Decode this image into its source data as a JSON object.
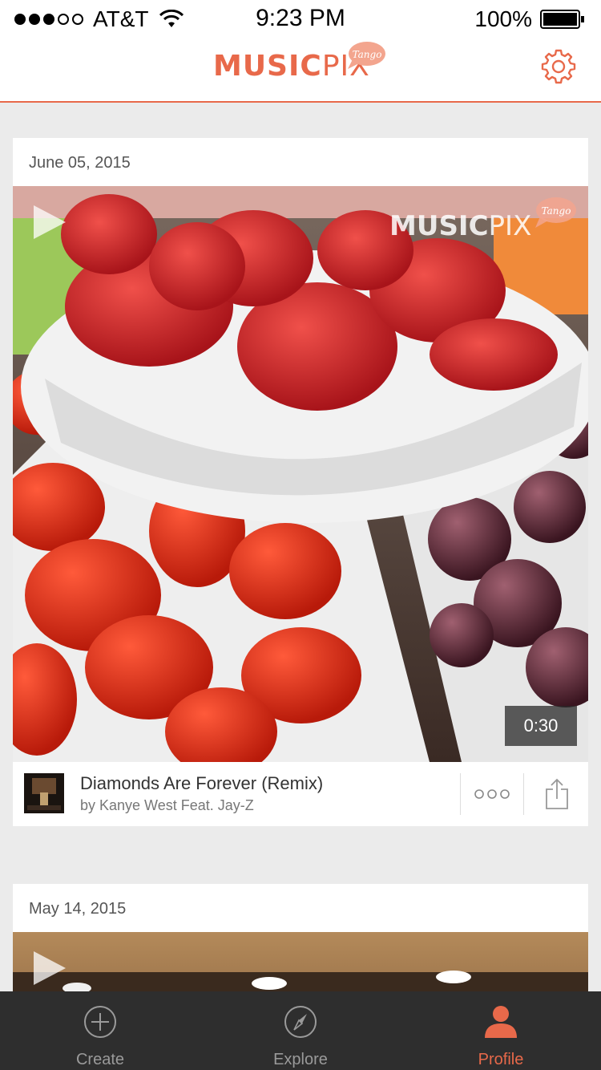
{
  "status_bar": {
    "carrier": "AT&T",
    "time": "9:23 PM",
    "battery": "100%"
  },
  "header": {
    "logo_bold": "MUSIC",
    "logo_light": "PIX",
    "logo_badge": "Tango"
  },
  "feed": [
    {
      "date": "June 05, 2015",
      "watermark_bold": "MUSIC",
      "watermark_light": "PIX",
      "watermark_badge": "Tango",
      "duration": "0:30",
      "track_title": "Diamonds Are Forever (Remix)",
      "track_artist": "by Kanye West Feat. Jay-Z"
    },
    {
      "date": "May 14, 2015"
    }
  ],
  "tabs": [
    {
      "label": "Create",
      "icon": "plus-circle-icon"
    },
    {
      "label": "Explore",
      "icon": "compass-icon"
    },
    {
      "label": "Profile",
      "icon": "person-icon",
      "active": true
    }
  ],
  "colors": {
    "accent": "#e8694a",
    "tab_bar": "#2e2e2e",
    "background": "#ebebeb"
  }
}
